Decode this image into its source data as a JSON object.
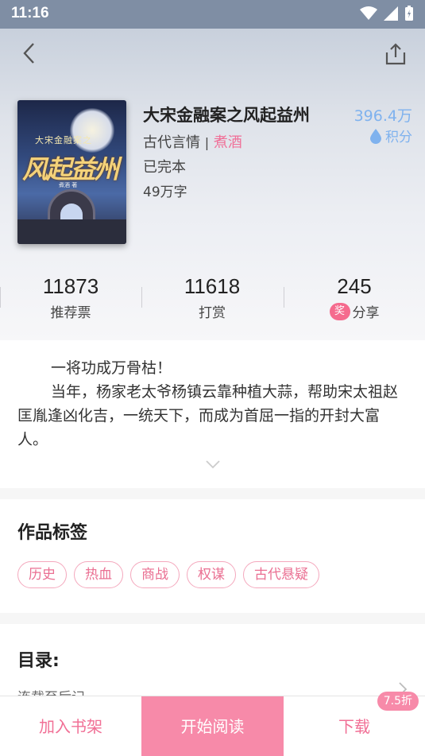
{
  "status_bar": {
    "time": "11:16"
  },
  "book": {
    "title": "大宋金融案之风起益州",
    "category": "古代言情",
    "author": "煮酒",
    "status": "已完本",
    "word_count": "49万字",
    "points_value": "396.4万",
    "points_label": "积分",
    "cover": {
      "subtitle": "大宋金融案之",
      "title": "风起益州",
      "author": "煮酒 著"
    }
  },
  "stats": [
    {
      "value": "11873",
      "label": "推荐票"
    },
    {
      "value": "11618",
      "label": "打赏"
    },
    {
      "value": "245",
      "label": "分享",
      "badge": "奖"
    }
  ],
  "description": {
    "p1": "一将功成万骨枯！",
    "p2": "当年，杨家老太爷杨镇云靠种植大蒜，帮助宋太祖赵匡胤逢凶化吉，一统天下，而成为首屈一指的开封大富人。"
  },
  "tags_section": {
    "title": "作品标签",
    "tags": [
      "历史",
      "热血",
      "商战",
      "权谋",
      "古代悬疑"
    ]
  },
  "toc": {
    "title": "目录:",
    "item": "连载至后记"
  },
  "bottom_bar": {
    "add_shelf": "加入书架",
    "start_reading": "开始阅读",
    "download": "下载",
    "discount": "7.5折"
  }
}
